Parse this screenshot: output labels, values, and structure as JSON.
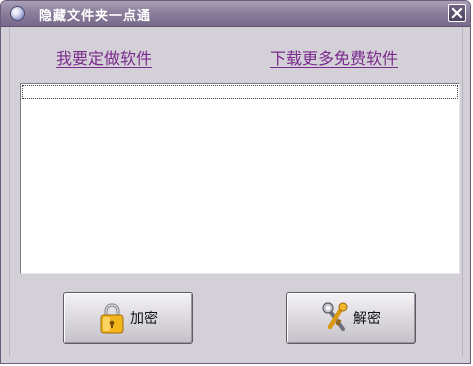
{
  "window": {
    "title": "隐藏文件夹一点通",
    "app_icon": "app-icon",
    "close_icon": "close-icon"
  },
  "links": {
    "custom_software": "我要定做软件",
    "download_more": "下载更多免费软件"
  },
  "file_list": {
    "items": []
  },
  "buttons": {
    "encrypt": {
      "label": "加密",
      "icon": "padlock-icon"
    },
    "decrypt": {
      "label": "解密",
      "icon": "key-tools-icon"
    }
  },
  "colors": {
    "titlebar": "#8c7f9c",
    "window_bg": "#d4d0d8",
    "link": "#7a2a8c"
  }
}
